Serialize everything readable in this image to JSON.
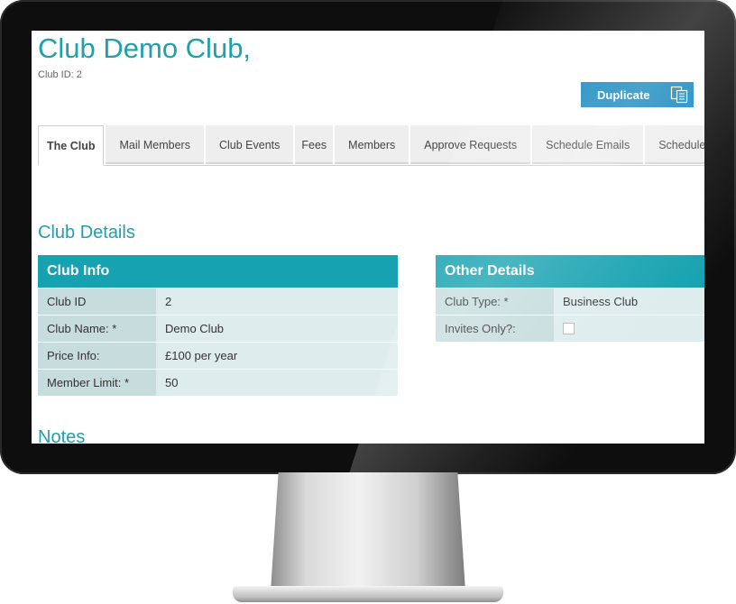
{
  "header": {
    "title": "Club Demo Club,",
    "subtitle": "Club ID: 2"
  },
  "toolbar": {
    "duplicate_label": "Duplicate",
    "duplicate_icon": "duplicate-icon"
  },
  "tabs": [
    {
      "label": "The Club",
      "active": true
    },
    {
      "label": "Mail Members"
    },
    {
      "label": "Club Events"
    },
    {
      "label": "Fees"
    },
    {
      "label": "Members"
    },
    {
      "label": "Approve Requests"
    },
    {
      "label": "Schedule Emails"
    },
    {
      "label": "Schedule Task"
    }
  ],
  "section_title": "Club Details",
  "club_info": {
    "title": "Club Info",
    "rows": [
      {
        "label": "Club ID",
        "value": "2"
      },
      {
        "label": "Club Name: *",
        "value": "Demo Club"
      },
      {
        "label": "Price Info:",
        "value": "£100 per year"
      },
      {
        "label": "Member Limit: *",
        "value": "50"
      }
    ]
  },
  "other_details": {
    "title": "Other Details",
    "rows": [
      {
        "label": "Club Type: *",
        "value": "Business Club"
      },
      {
        "label": "Invites Only?:",
        "checked": false
      }
    ]
  },
  "notes_title": "Notes",
  "colors": {
    "accent": "#1fa0ab",
    "panel_header": "#16a2b0",
    "button": "#1588bd",
    "label_cell": "#c6dcdd",
    "value_cell": "#deeced"
  }
}
